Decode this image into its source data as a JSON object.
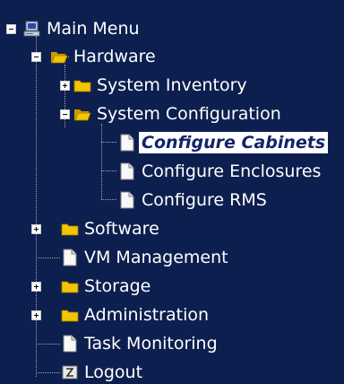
{
  "tree": {
    "root": {
      "label": "Main Menu",
      "icon": "computer-icon",
      "expanded": true
    },
    "hardware": {
      "label": "Hardware",
      "icon": "open-folder-icon",
      "expanded": true
    },
    "system_inventory": {
      "label": "System Inventory",
      "icon": "folder-icon",
      "expanded": false
    },
    "system_configuration": {
      "label": "System Configuration",
      "icon": "open-folder-icon",
      "expanded": true
    },
    "configure_cabinets": {
      "label": "Configure Cabinets",
      "icon": "document-icon",
      "selected": true
    },
    "configure_enclosures": {
      "label": "Configure Enclosures",
      "icon": "document-icon"
    },
    "configure_rms": {
      "label": "Configure RMS",
      "icon": "document-icon"
    },
    "software": {
      "label": "Software",
      "icon": "folder-icon",
      "expanded": false
    },
    "vm_management": {
      "label": "VM Management",
      "icon": "document-icon"
    },
    "storage": {
      "label": "Storage",
      "icon": "folder-icon",
      "expanded": false
    },
    "administration": {
      "label": "Administration",
      "icon": "folder-icon",
      "expanded": false
    },
    "task_monitoring": {
      "label": "Task Monitoring",
      "icon": "document-icon"
    },
    "logout": {
      "label": "Logout",
      "icon": "logout-icon"
    }
  },
  "colors": {
    "background": "#0d1f4f",
    "text": "#ffffff",
    "folder": "#f3c400",
    "selected_text": "#12256a"
  }
}
